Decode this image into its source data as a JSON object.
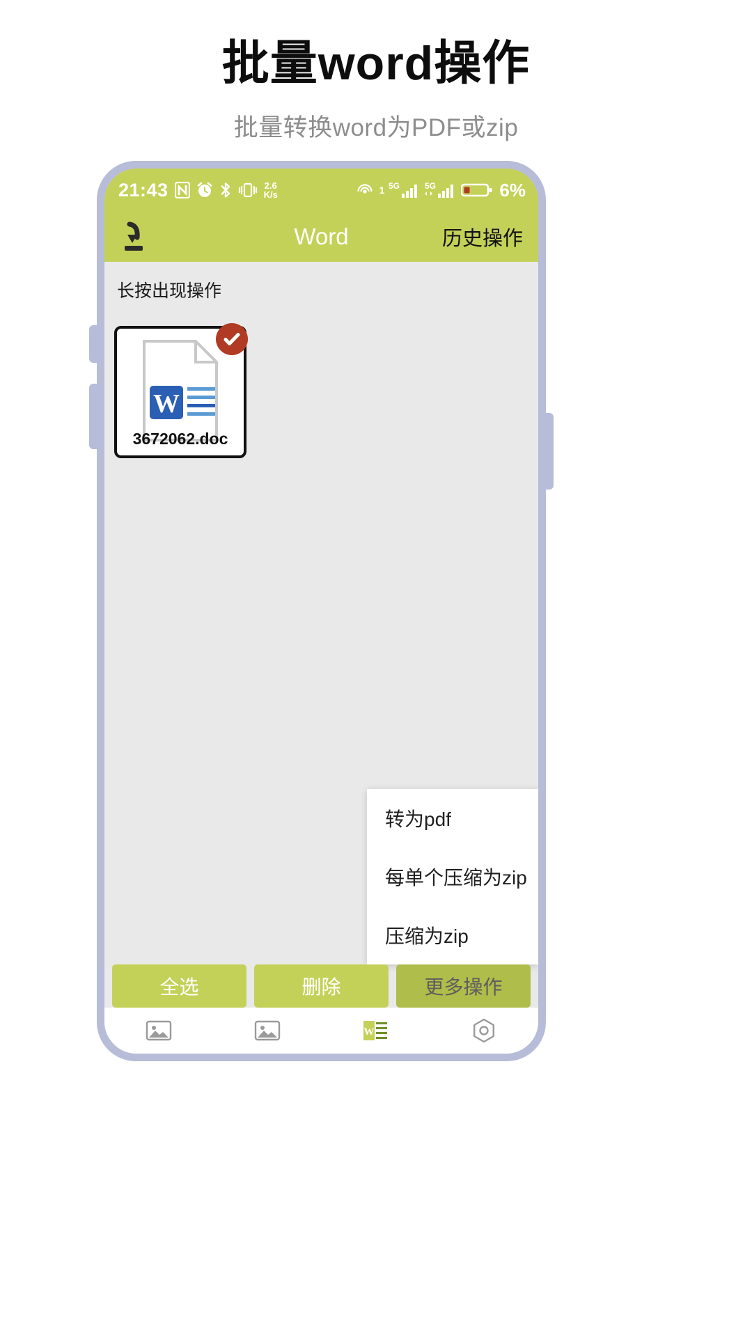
{
  "headline": "批量word操作",
  "subhead": "批量转换word为PDF或zip",
  "statusbar": {
    "time": "21:43",
    "nfc_icon": "nfc-icon",
    "alarm_icon": "alarm-icon",
    "bluetooth_icon": "bluetooth-icon",
    "vibrate_icon": "vibrate-icon",
    "net_speed_value": "2.6",
    "net_speed_unit": "K/s",
    "wifi_icon": "wifi-icon",
    "wifi_sup": "1",
    "sim1_label": "5G",
    "sim2_label": "5G",
    "battery_icon": "battery-icon",
    "battery_percent": "6%"
  },
  "appbar": {
    "download_icon": "download-icon",
    "title": "Word",
    "history_label": "历史操作"
  },
  "content": {
    "hint": "长按出现操作",
    "file": {
      "name": "3672062.doc",
      "doc_icon": "word-document-icon",
      "selected_icon": "check-circle-icon",
      "badge_color": "#b03a23"
    }
  },
  "popup_menu": {
    "items": [
      {
        "label": "转为pdf"
      },
      {
        "label": "每单个压缩为zip"
      },
      {
        "label": "压缩为zip"
      }
    ]
  },
  "action_bar": {
    "buttons": [
      {
        "label": "全选",
        "active": false
      },
      {
        "label": "删除",
        "active": false
      },
      {
        "label": "更多操作",
        "active": true
      }
    ]
  },
  "bottom_nav": {
    "items": [
      {
        "icon": "image-icon"
      },
      {
        "icon": "image-icon"
      },
      {
        "icon": "word-icon"
      },
      {
        "icon": "settings-icon"
      }
    ]
  },
  "colors": {
    "accent_green": "#c4d158",
    "accent_green_active": "#afbd4b",
    "frame": "#b7bcd8",
    "screen_bg": "#e9e9e9"
  }
}
